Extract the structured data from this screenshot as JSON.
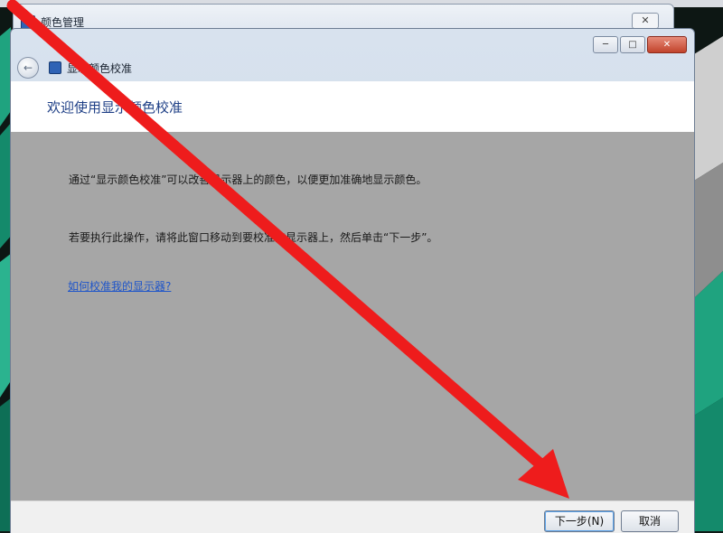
{
  "background_window": {
    "title": "颜色管理",
    "close_glyph": "✕"
  },
  "window": {
    "caption_buttons": {
      "minimize": "─",
      "maximize": "□",
      "close": "✕"
    },
    "nav": {
      "back_glyph": "←",
      "title": "显示颜色校准"
    },
    "heading": "欢迎使用显示颜色校准",
    "paragraph_1": "通过“显示颜色校准”可以改善显示器上的颜色，以便更加准确地显示颜色。",
    "paragraph_2": "若要执行此操作，请将此窗口移动到要校准的显示器上，然后单击“下一步”。",
    "help_link": "如何校准我的显示器?",
    "buttons": {
      "next": "下一步(N)",
      "cancel": "取消"
    }
  },
  "annotation": {
    "arrow_color": "#ee1c1c"
  },
  "colors": {
    "heading": "#1e3f86",
    "link": "#1f55c9",
    "content_bg": "#a6a6a6"
  }
}
